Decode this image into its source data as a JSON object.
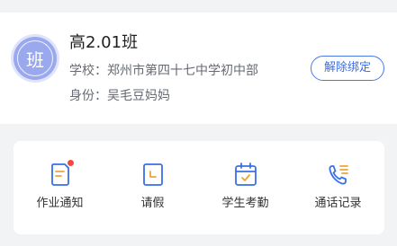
{
  "class_card": {
    "avatar_char": "班",
    "title": "高2.01班",
    "school_line": "学校：郑州市第四十七中学初中部",
    "identity_line": "身份：吴毛豆妈妈",
    "unbind_label": "解除绑定"
  },
  "functions": [
    {
      "label": "作业通知",
      "icon": "homework-notice-icon",
      "has_badge": true
    },
    {
      "label": "请假",
      "icon": "leave-request-icon",
      "has_badge": false
    },
    {
      "label": "学生考勤",
      "icon": "attendance-calendar-icon",
      "has_badge": false
    },
    {
      "label": "通话记录",
      "icon": "call-records-icon",
      "has_badge": false
    }
  ],
  "colors": {
    "accent": "#3d6ee8",
    "icon_primary": "#3a6fe8",
    "icon_secondary": "#f0a23a",
    "badge": "#f2493f",
    "avatar": "#9aa8ee"
  }
}
